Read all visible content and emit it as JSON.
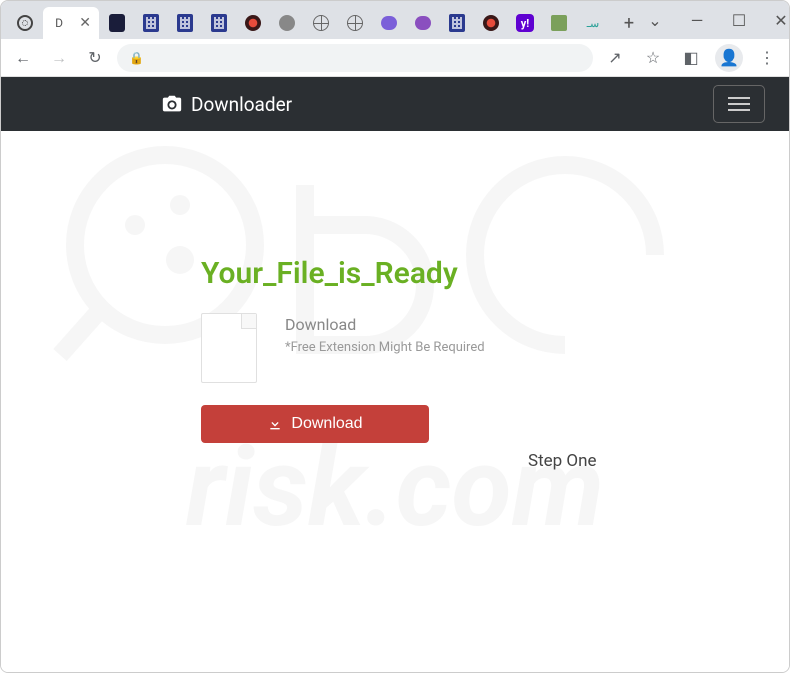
{
  "window": {
    "dropdown_glyph": "⌄",
    "minimize_glyph": "—",
    "maximize_glyph": "☐",
    "close_glyph": "✕"
  },
  "tabs": {
    "active_label": "D",
    "close_glyph": "✕",
    "new_tab_glyph": "+",
    "yahoo_label": "y!"
  },
  "toolbar": {
    "back_glyph": "←",
    "forward_glyph": "→",
    "reload_glyph": "↻",
    "lock_glyph": "🔒",
    "share_glyph": "↗",
    "star_glyph": "☆",
    "ext_glyph": "◧",
    "profile_glyph": "👤",
    "menu_glyph": "⋮"
  },
  "navbar": {
    "brand": "Downloader"
  },
  "page": {
    "headline": "Your_File_is_Ready",
    "file_title": "Download",
    "file_sub": "*Free Extension Might Be Required",
    "button_label": "Download",
    "step_label": "Step One"
  },
  "watermark": {
    "text": "risk.com"
  }
}
